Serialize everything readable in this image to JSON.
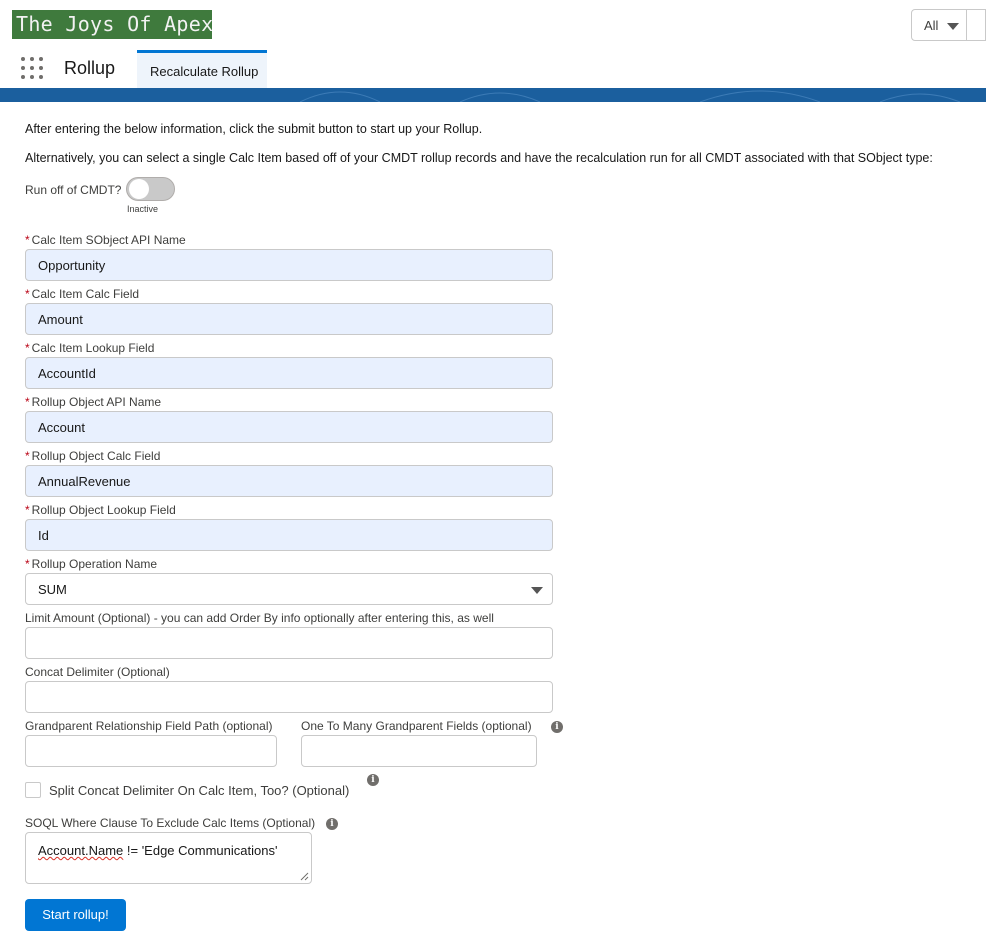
{
  "header": {
    "logo_text": "The Joys Of Apex",
    "search_scope": "All"
  },
  "nav": {
    "app_name": "Rollup",
    "tab_label": "Recalculate Rollup"
  },
  "intro": {
    "line1": "After entering the below information, click the submit button to start up your Rollup.",
    "line2": "Alternatively, you can select a single Calc Item based off of your CMDT rollup records and have the recalculation run for all CMDT associated with that SObject type:"
  },
  "cmdt_toggle": {
    "label": "Run off of CMDT?",
    "state": "Inactive"
  },
  "fields": {
    "calc_item_sobject": {
      "label": "Calc Item SObject API Name",
      "value": "Opportunity"
    },
    "calc_item_calc_field": {
      "label": "Calc Item Calc Field",
      "value": "Amount"
    },
    "calc_item_lookup_field": {
      "label": "Calc Item Lookup Field",
      "value": "AccountId"
    },
    "rollup_object_api": {
      "label": "Rollup Object API Name",
      "value": "Account"
    },
    "rollup_object_calc_field": {
      "label": "Rollup Object Calc Field",
      "value": "AnnualRevenue"
    },
    "rollup_object_lookup_field": {
      "label": "Rollup Object Lookup Field",
      "value": "Id"
    },
    "rollup_operation": {
      "label": "Rollup Operation Name",
      "value": "SUM"
    },
    "limit_amount": {
      "label": "Limit Amount (Optional) - you can add Order By info optionally after entering this, as well",
      "value": ""
    },
    "concat_delimiter": {
      "label": "Concat Delimiter (Optional)",
      "value": ""
    },
    "grandparent_path": {
      "label": "Grandparent Relationship Field Path (optional)",
      "value": ""
    },
    "one_to_many_grandparent": {
      "label": "One To Many Grandparent Fields (optional)",
      "value": ""
    },
    "split_concat": {
      "label": "Split Concat Delimiter On Calc Item, Too? (Optional)",
      "checked": false
    },
    "soql_where": {
      "label": "SOQL Where Clause To Exclude Calc Items (Optional)",
      "value_underlined": "Account.Name",
      "value_rest": " != 'Edge Communications'"
    }
  },
  "submit_label": "Start rollup!",
  "required_marker": "*",
  "info_glyph": "i",
  "colors": {
    "brand_blue": "#0176d3",
    "banner_blue": "#1b5f9e",
    "logo_green": "#3f7a3d",
    "autofill_bg": "#e8f0fe",
    "required_red": "#ba0517"
  }
}
